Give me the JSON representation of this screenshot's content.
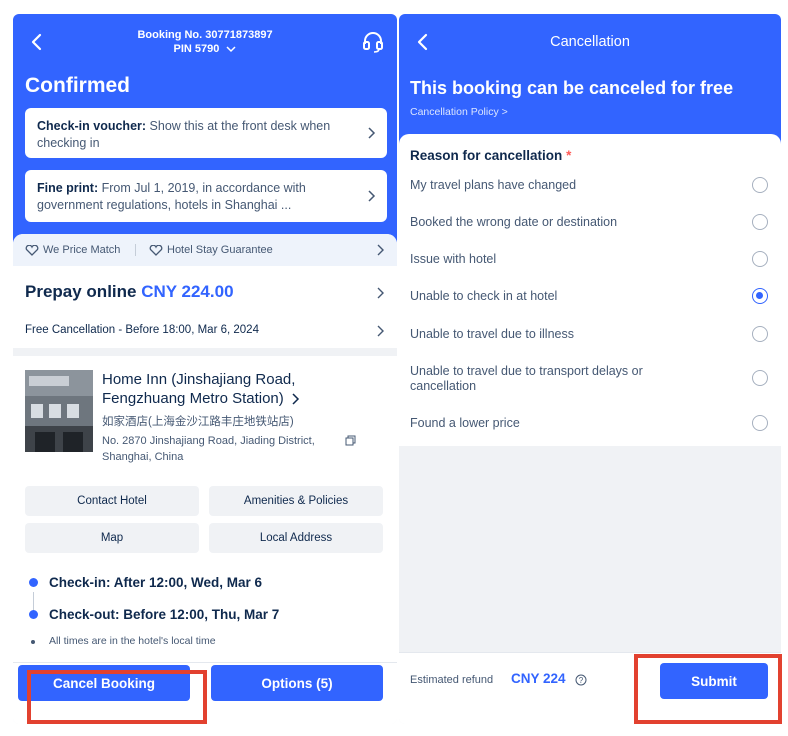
{
  "left": {
    "booking_no": "Booking No. 30771873897",
    "pin": "PIN 5790",
    "status": "Confirmed",
    "voucher": {
      "label": "Check-in voucher:",
      "text": "Show this at the front desk when checking in"
    },
    "fineprint": {
      "label": "Fine print:",
      "text": "From Jul 1, 2019, in accordance with government regulations, hotels in Shanghai ..."
    },
    "guarantees": [
      "We Price Match",
      "Hotel Stay Guarantee"
    ],
    "prepay": {
      "label": "Prepay online",
      "amount": "CNY 224.00"
    },
    "free_cancel": "Free Cancellation - Before 18:00, Mar 6, 2024",
    "hotel": {
      "name": "Home Inn (Jinshajiang Road, Fengzhuang Metro Station)",
      "name_cn": "如家酒店(上海金沙江路丰庄地铁站店)",
      "address": "No. 2870 Jinshajiang Road, Jiading District, Shanghai, China"
    },
    "actions": [
      "Contact Hotel",
      "Amenities & Policies",
      "Map",
      "Local Address"
    ],
    "checkin": "Check-in: After 12:00, Wed, Mar 6",
    "checkout": "Check-out: Before 12:00, Thu, Mar 7",
    "times_note": "All times are in the hotel's local time",
    "cancel_button": "Cancel Booking",
    "options_button": "Options (5)"
  },
  "right": {
    "nav_title": "Cancellation",
    "free_title": "This booking can be canceled for free",
    "policy_link": "Cancellation Policy >",
    "reason_title": "Reason for cancellation",
    "required_mark": "*",
    "reasons": [
      {
        "label": "My travel plans have changed",
        "selected": false
      },
      {
        "label": "Booked the wrong date or destination",
        "selected": false
      },
      {
        "label": "Issue with hotel",
        "selected": false
      },
      {
        "label": "Unable to check in at hotel",
        "selected": true
      },
      {
        "label": "Unable to travel due to illness",
        "selected": false
      },
      {
        "label": "Unable to travel due to transport delays or cancellation",
        "selected": false
      },
      {
        "label": "Found a lower price",
        "selected": false
      }
    ],
    "refund_label": "Estimated refund",
    "refund_amount": "CNY 224",
    "submit_button": "Submit"
  },
  "colors": {
    "brand_blue": "#3264ff",
    "highlight_red": "#e2412f"
  },
  "icons": [
    "back-arrow-icon",
    "chevron-down-icon",
    "headset-icon",
    "chevron-right-icon",
    "heart-shield-icon",
    "copy-icon",
    "info-icon"
  ]
}
